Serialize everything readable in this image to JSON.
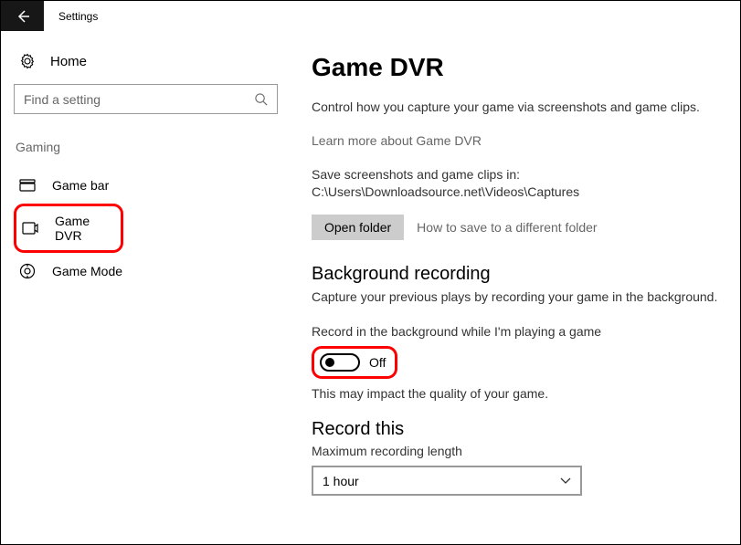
{
  "app": {
    "title": "Settings"
  },
  "sidebar": {
    "home_label": "Home",
    "search_placeholder": "Find a setting",
    "category": "Gaming",
    "items": [
      {
        "label": "Game bar"
      },
      {
        "label": "Game DVR"
      },
      {
        "label": "Game Mode"
      }
    ]
  },
  "main": {
    "title": "Game DVR",
    "description": "Control how you capture your game via screenshots and game clips.",
    "learn_more": "Learn more about Game DVR",
    "save_path_text": "Save screenshots and game clips in: C:\\Users\\Downloadsource.net\\Videos\\Captures",
    "open_folder_label": "Open folder",
    "folder_help": "How to save to a different folder",
    "bg_recording_heading": "Background recording",
    "bg_recording_desc": "Capture your previous plays by recording your game in the background.",
    "toggle_label": "Record in the background while I'm playing a game",
    "toggle_state": "Off",
    "impact_note": "This may impact the quality of your game.",
    "record_this_heading": "Record this",
    "max_length_label": "Maximum recording length",
    "max_length_value": "1 hour"
  }
}
